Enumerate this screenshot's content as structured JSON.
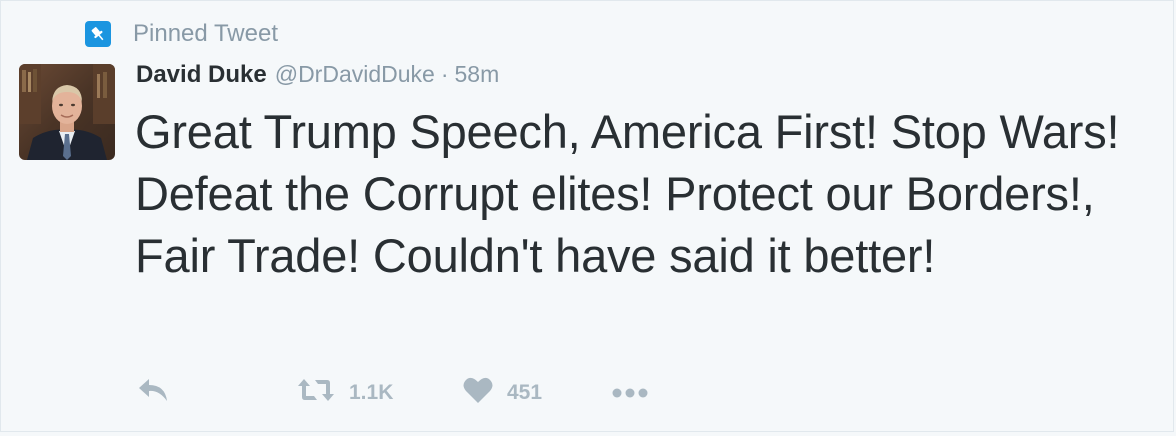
{
  "pinned": {
    "label": "Pinned Tweet",
    "icon": "pin-icon"
  },
  "author": {
    "name": "David Duke",
    "handle": "@DrDavidDuke",
    "separator": "·",
    "time": "58m"
  },
  "tweet": {
    "text": "Great Trump Speech, America First! Stop Wars! Defeat the Corrupt elites! Protect our Borders!, Fair Trade! Couldn't have said it better!"
  },
  "actions": {
    "reply_icon": "reply-icon",
    "retweet_icon": "retweet-icon",
    "retweet_count": "1.1K",
    "like_icon": "heart-icon",
    "like_count": "451",
    "more_icon": "more-icon"
  },
  "colors": {
    "background": "#f5f8fa",
    "accent": "#1b95e0",
    "text": "#292f33",
    "muted": "#8899a6",
    "action_gray": "#aab8c2"
  }
}
